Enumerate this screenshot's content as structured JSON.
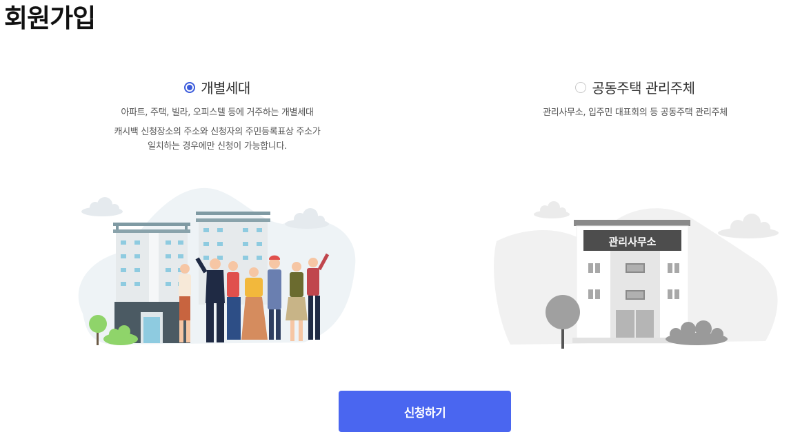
{
  "page": {
    "title": "회원가입"
  },
  "options": [
    {
      "label": "개별세대",
      "selected": true,
      "description": "아파트, 주택, 빌라, 오피스텔 등에 거주하는 개별세대",
      "note_line1": "캐시백 신청장소의 주소와 신청자의 주민등록표상 주소가",
      "note_line2": "일치하는 경우에만 신청이 가능합니다."
    },
    {
      "label": "공동주택 관리주체",
      "selected": false,
      "description": "관리사무소, 입주민 대표회의 등 공동주택 관리주체"
    }
  ],
  "illustration": {
    "office_sign": "관리사무소"
  },
  "submit": {
    "label": "신청하기"
  },
  "colors": {
    "accent": "#4a66f0",
    "radio": "#3b5bdb"
  }
}
